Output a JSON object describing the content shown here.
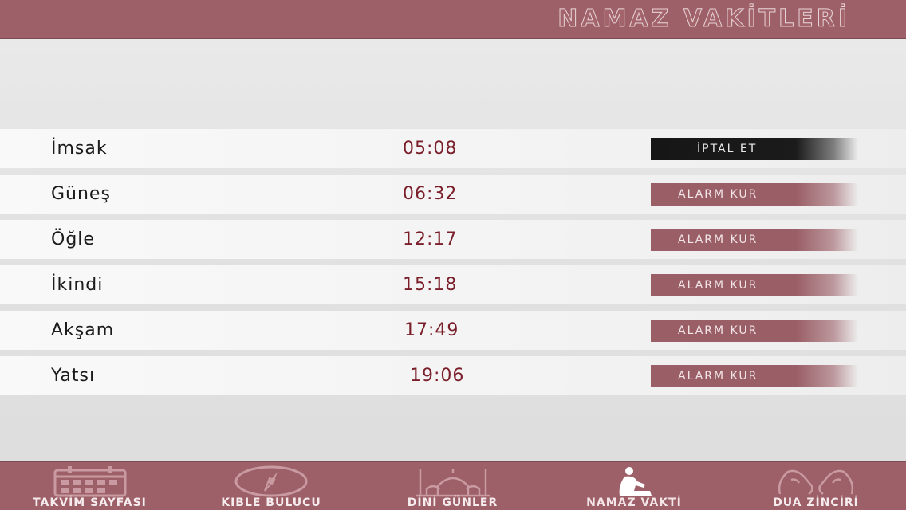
{
  "header": {
    "title": "NAMAZ VAKİTLERİ"
  },
  "prayers": [
    {
      "name": "İmsak",
      "time": "05:08",
      "action": "İPTAL ET",
      "state": "set"
    },
    {
      "name": "Güneş",
      "time": "06:32",
      "action": "ALARM KUR",
      "state": "unset"
    },
    {
      "name": "Öğle",
      "time": "12:17",
      "action": "ALARM KUR",
      "state": "unset"
    },
    {
      "name": "İkindi",
      "time": "15:18",
      "action": "ALARM KUR",
      "state": "unset"
    },
    {
      "name": "Akşam",
      "time": "17:49",
      "action": "ALARM KUR",
      "state": "unset"
    },
    {
      "name": "Yatsı",
      "time": "19:06",
      "action": "ALARM KUR",
      "state": "unset"
    }
  ],
  "tabs": [
    {
      "label": "TAKVİM SAYFASI",
      "icon": "calendar-icon"
    },
    {
      "label": "KIBLE BULUCU",
      "icon": "compass-icon"
    },
    {
      "label": "DİNİ GÜNLER",
      "icon": "mosque-icon"
    },
    {
      "label": "NAMAZ VAKTİ",
      "icon": "praying-person-icon",
      "active": true
    },
    {
      "label": "DUA ZİNCİRİ",
      "icon": "praying-hands-icon"
    }
  ],
  "colors": {
    "brand": "#9d6068",
    "time_text": "#7a1f2a",
    "cancel_button": "#161616"
  }
}
